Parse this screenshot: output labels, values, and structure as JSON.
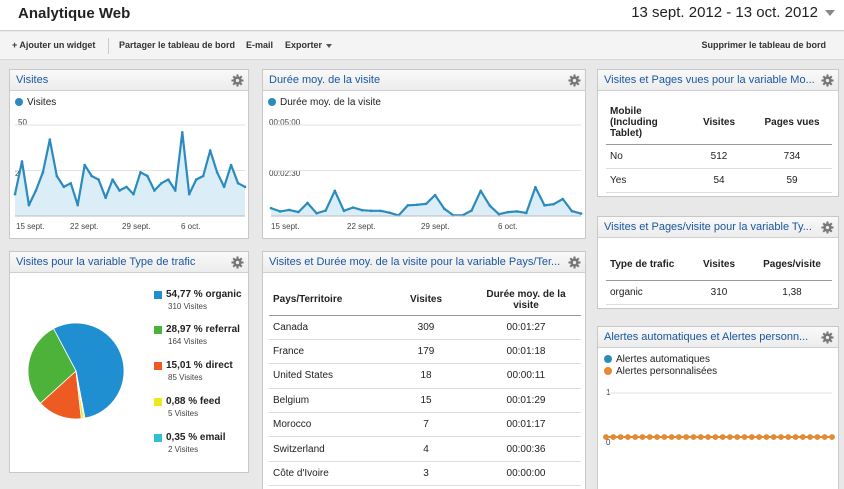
{
  "header": {
    "title": "Analytique Web",
    "date_range": "13 sept. 2012 - 13 oct. 2012"
  },
  "toolbar": {
    "add_widget": "+ Ajouter un widget",
    "share": "Partager le tableau de bord",
    "email": "E-mail",
    "export": "Exporter",
    "delete": "Supprimer le tableau de bord"
  },
  "colors": {
    "line": "#2b8bbf",
    "fill": "#dbeef7",
    "organic": "#1f8fd1",
    "referral": "#4cb23a",
    "direct": "#ed5a22",
    "feed": "#f0e61c",
    "email": "#2fc0d4",
    "orange": "#e9892d"
  },
  "widget_visits": {
    "title": "Visites",
    "legend": "Visites",
    "y_top": "50",
    "y_mid": "25",
    "x_labels": [
      "15 sept.",
      "22 sept.",
      "29 sept.",
      "6 oct."
    ]
  },
  "widget_duration": {
    "title": "Durée moy. de la visite",
    "legend": "Durée moy. de la visite",
    "y_top": "00:05:00",
    "y_mid": "00:02:30",
    "x_labels": [
      "15 sept.",
      "22 sept.",
      "29 sept.",
      "6 oct."
    ]
  },
  "widget_mobile": {
    "title": "Visites et Pages vues pour la variable Mo...",
    "headers": [
      "Mobile (Including Tablet)",
      "Visites",
      "Pages vues"
    ],
    "rows": [
      [
        "No",
        "512",
        "734"
      ],
      [
        "Yes",
        "54",
        "59"
      ]
    ]
  },
  "widget_traffic": {
    "title": "Visites pour la variable Type de trafic",
    "items": [
      {
        "label": "54,77 % organic",
        "sub": "310 Visites"
      },
      {
        "label": "28,97 % referral",
        "sub": "164 Visites"
      },
      {
        "label": "15,01 % direct",
        "sub": "85 Visites"
      },
      {
        "label": "0,88 % feed",
        "sub": "5 Visites"
      },
      {
        "label": "0,35 % email",
        "sub": "2 Visites"
      }
    ]
  },
  "widget_country": {
    "title": "Visites et Durée moy. de la visite pour la variable Pays/Ter...",
    "headers": [
      "Pays/Territoire",
      "Visites",
      "Durée moy. de la visite"
    ],
    "rows": [
      [
        "Canada",
        "309",
        "00:01:27"
      ],
      [
        "France",
        "179",
        "00:01:18"
      ],
      [
        "United States",
        "18",
        "00:00:11"
      ],
      [
        "Belgium",
        "15",
        "00:01:29"
      ],
      [
        "Morocco",
        "7",
        "00:01:17"
      ],
      [
        "Switzerland",
        "4",
        "00:00:36"
      ],
      [
        "Côte d'Ivoire",
        "3",
        "00:00:00"
      ]
    ]
  },
  "widget_pagesvisit": {
    "title": "Visites et Pages/visite pour la variable Ty...",
    "headers": [
      "Type de trafic",
      "Visites",
      "Pages/visite"
    ],
    "rows": [
      [
        "organic",
        "310",
        "1,38"
      ]
    ]
  },
  "widget_alerts": {
    "title": "Alertes automatiques et Alertes personn...",
    "legend1": "Alertes automatiques",
    "legend2": "Alertes personnalisées",
    "y_top": "1",
    "y_bottom": "0"
  },
  "chart_data": [
    {
      "type": "area",
      "title": "Visites",
      "series": [
        {
          "name": "Visites",
          "values": [
            12,
            30,
            6,
            14,
            24,
            42,
            22,
            16,
            18,
            6,
            28,
            22,
            20,
            10,
            20,
            14,
            16,
            12,
            24,
            22,
            14,
            18,
            20,
            14,
            46,
            12,
            20,
            22,
            36,
            24,
            16,
            28,
            18,
            16
          ]
        }
      ],
      "x_tick_labels": [
        "15 sept.",
        "22 sept.",
        "29 sept.",
        "6 oct."
      ],
      "ylim": [
        0,
        50
      ]
    },
    {
      "type": "area",
      "title": "Durée moy. de la visite",
      "series": [
        {
          "name": "Durée moy. de la visite",
          "values": [
            26,
            15,
            20,
            13,
            43,
            9,
            18,
            83,
            17,
            28,
            19,
            17,
            17,
            11,
            2,
            35,
            37,
            40,
            69,
            24,
            2,
            2,
            18,
            83,
            34,
            6,
            13,
            15,
            10,
            95,
            35,
            39,
            56,
            16,
            8
          ]
        }
      ],
      "x_tick_labels": [
        "15 sept.",
        "22 sept.",
        "29 sept.",
        "6 oct."
      ],
      "ylim": [
        0,
        300
      ]
    },
    {
      "type": "pie",
      "title": "Visites pour la variable Type de trafic",
      "categories": [
        "organic",
        "referral",
        "direct",
        "feed",
        "email"
      ],
      "values": [
        310,
        164,
        85,
        5,
        2
      ]
    },
    {
      "type": "line",
      "title": "Alertes automatiques et Alertes personn...",
      "series": [
        {
          "name": "Alertes automatiques",
          "values": [
            0,
            0,
            0,
            0,
            0,
            0,
            0,
            0,
            0,
            0,
            0,
            0,
            0,
            0,
            0,
            0,
            0,
            0,
            0,
            0,
            0,
            0,
            0,
            0,
            0,
            0,
            0,
            0,
            0,
            0,
            0,
            0
          ]
        },
        {
          "name": "Alertes personnalisées",
          "values": [
            0,
            0,
            0,
            0,
            0,
            0,
            0,
            0,
            0,
            0,
            0,
            0,
            0,
            0,
            0,
            0,
            0,
            0,
            0,
            0,
            0,
            0,
            0,
            0,
            0,
            0,
            0,
            0,
            0,
            0,
            0,
            0
          ]
        }
      ],
      "ylim": [
        0,
        1
      ]
    }
  ]
}
